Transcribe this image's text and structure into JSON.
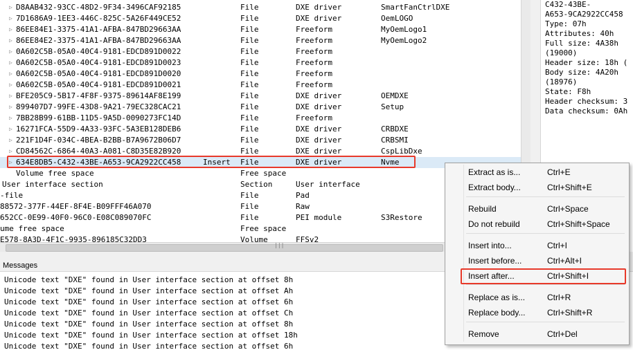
{
  "tree": {
    "rows": [
      {
        "name": "D8AAB432-93CC-48D2-9F34-3496CAF92185",
        "action": "",
        "type": "File",
        "subtype": "DXE driver",
        "text": "SmartFanCtrlDXE"
      },
      {
        "name": "7D1686A9-1EE3-446C-825C-5A26F449CE52",
        "action": "",
        "type": "File",
        "subtype": "DXE driver",
        "text": "OemLOGO"
      },
      {
        "name": "86EE84E1-3375-41A1-AFBA-847BD29663AA",
        "action": "",
        "type": "File",
        "subtype": "Freeform",
        "text": "MyOemLogo1"
      },
      {
        "name": "86EE84E2-3375-41A1-AFBA-847BD29663AA",
        "action": "",
        "type": "File",
        "subtype": "Freeform",
        "text": "MyOemLogo2"
      },
      {
        "name": "0A602C5B-05A0-40C4-9181-EDCD891D0022",
        "action": "",
        "type": "File",
        "subtype": "Freeform",
        "text": ""
      },
      {
        "name": "0A602C5B-05A0-40C4-9181-EDCD891D0023",
        "action": "",
        "type": "File",
        "subtype": "Freeform",
        "text": ""
      },
      {
        "name": "0A602C5B-05A0-40C4-9181-EDCD891D0020",
        "action": "",
        "type": "File",
        "subtype": "Freeform",
        "text": ""
      },
      {
        "name": "0A602C5B-05A0-40C4-9181-EDCD891D0021",
        "action": "",
        "type": "File",
        "subtype": "Freeform",
        "text": ""
      },
      {
        "name": "BFE205C9-5B17-4F8F-9375-89614AF8E199",
        "action": "",
        "type": "File",
        "subtype": "DXE driver",
        "text": "OEMDXE"
      },
      {
        "name": "899407D7-99FE-43D8-9A21-79EC328CAC21",
        "action": "",
        "type": "File",
        "subtype": "DXE driver",
        "text": "Setup"
      },
      {
        "name": "7BB28B99-61BB-11D5-9A5D-0090273FC14D",
        "action": "",
        "type": "File",
        "subtype": "Freeform",
        "text": ""
      },
      {
        "name": "16271FCA-55D9-4A33-93FC-5A3EB128DEB6",
        "action": "",
        "type": "File",
        "subtype": "DXE driver",
        "text": "CRBDXE"
      },
      {
        "name": "221F1D4F-034C-4BEA-B2BB-B7A9672B06D7",
        "action": "",
        "type": "File",
        "subtype": "DXE driver",
        "text": "CRBSMI"
      },
      {
        "name": "CD84562C-6864-40A3-A081-C8D35E82B920",
        "action": "",
        "type": "File",
        "subtype": "DXE driver",
        "text": "CspLibDxe"
      },
      {
        "name": "634E8DB5-C432-43BE-A653-9CA2922CC458",
        "action": "Insert",
        "type": "File",
        "subtype": "DXE driver",
        "text": "Nvme"
      },
      {
        "name": "Volume free space",
        "action": "",
        "type": "Free space",
        "subtype": "",
        "text": ""
      },
      {
        "name": "User interface section",
        "action": "",
        "type": "Section",
        "subtype": "User interface",
        "text": ""
      },
      {
        "name": "-file",
        "action": "",
        "type": "File",
        "subtype": "Pad",
        "text": ""
      },
      {
        "name": "88572-377F-44EF-8F4E-B09FFF46A070",
        "action": "",
        "type": "File",
        "subtype": "Raw",
        "text": ""
      },
      {
        "name": "652CC-0E99-40F0-96C0-E08C089070FC",
        "action": "",
        "type": "File",
        "subtype": "PEI module",
        "text": "S3Restore"
      },
      {
        "name": "ume free space",
        "action": "",
        "type": "Free space",
        "subtype": "",
        "text": ""
      },
      {
        "name": "E578-8A3D-4F1C-9935-896185C32DD3",
        "action": "",
        "type": "Volume",
        "subtype": "FFSv2",
        "text": ""
      }
    ]
  },
  "info": {
    "lines": [
      "C432-43BE-",
      "A653-9CA2922CC458",
      "Type: 07h",
      "Attributes: 40h",
      "Full size: 4A38h",
      "(19000)",
      "Header size: 18h (",
      "Body size: 4A20h",
      "(18976)",
      "State: F8h",
      "Header checksum: 3",
      "Data checksum: 0Ah"
    ]
  },
  "messages": {
    "title": "Messages",
    "lines": [
      "Unicode text \"DXE\" found in User interface section at offset 8h",
      "Unicode text \"DXE\" found in User interface section at offset Ah",
      "Unicode text \"DXE\" found in User interface section at offset 6h",
      "Unicode text \"DXE\" found in User interface section at offset Ch",
      "Unicode text \"DXE\" found in User interface section at offset 8h",
      "Unicode text \"DXE\" found in User interface section at offset 18h",
      "Unicode text \"DXE\" found in User interface section at offset 6h"
    ]
  },
  "context_menu": {
    "groups": [
      [
        {
          "id": "extract-as-is",
          "label": "Extract as is...",
          "shortcut": "Ctrl+E"
        },
        {
          "id": "extract-body",
          "label": "Extract body...",
          "shortcut": "Ctrl+Shift+E"
        }
      ],
      [
        {
          "id": "rebuild",
          "label": "Rebuild",
          "shortcut": "Ctrl+Space"
        },
        {
          "id": "do-not-rebuild",
          "label": "Do not rebuild",
          "shortcut": "Ctrl+Shift+Space"
        }
      ],
      [
        {
          "id": "insert-into",
          "label": "Insert into...",
          "shortcut": "Ctrl+I"
        },
        {
          "id": "insert-before",
          "label": "Insert before...",
          "shortcut": "Ctrl+Alt+I"
        },
        {
          "id": "insert-after",
          "label": "Insert after...",
          "shortcut": "Ctrl+Shift+I"
        }
      ],
      [
        {
          "id": "replace-as-is",
          "label": "Replace as is...",
          "shortcut": "Ctrl+R"
        },
        {
          "id": "replace-body",
          "label": "Replace body...",
          "shortcut": "Ctrl+Shift+R"
        }
      ],
      [
        {
          "id": "remove",
          "label": "Remove",
          "shortcut": "Ctrl+Del"
        }
      ]
    ]
  },
  "colors": {
    "highlight_border": "#e8392a",
    "selection": "#dbeaf7"
  }
}
